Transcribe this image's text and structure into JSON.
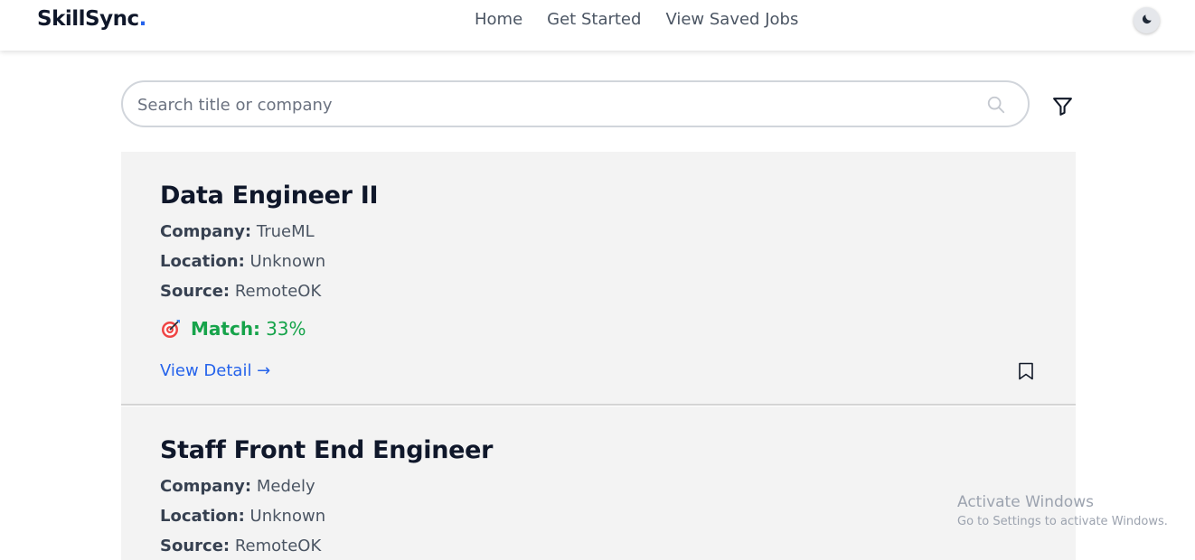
{
  "navbar": {
    "brand": "SkillSync",
    "brand_dot": ".",
    "links": [
      "Home",
      "Get Started",
      "View Saved Jobs"
    ],
    "theme_icon": "moon-icon"
  },
  "search": {
    "placeholder": "Search title or company",
    "value": "",
    "icon": "search-icon",
    "filter_icon": "filter-icon"
  },
  "jobs": [
    {
      "title": "Data Engineer II",
      "company_label": "Company:",
      "company": "TrueML",
      "location_label": "Location:",
      "location": "Unknown",
      "source_label": "Source:",
      "source": "RemoteOK",
      "match_label": "Match:",
      "match": "33%",
      "detail_link": "View Detail →"
    },
    {
      "title": "Staff Front End Engineer",
      "company_label": "Company:",
      "company": "Medely",
      "location_label": "Location:",
      "location": "Unknown",
      "source_label": "Source:",
      "source": "RemoteOK"
    }
  ],
  "watermark": {
    "title": "Activate Windows",
    "subtitle": "Go to Settings to activate Windows."
  },
  "colors": {
    "brand_dot": "#2563eb",
    "match": "#16a34a",
    "link": "#2563eb",
    "card_bg": "#f3f3f3"
  }
}
